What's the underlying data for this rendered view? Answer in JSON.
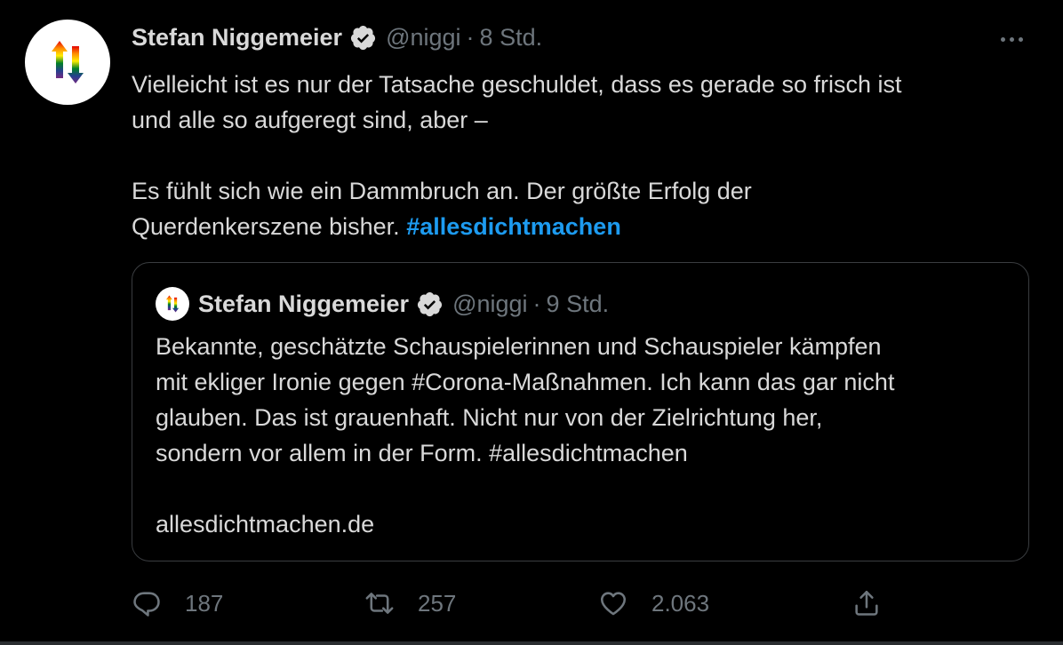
{
  "colors": {
    "background": "#000000",
    "text": "#d9d9d9",
    "secondary": "#6e767d",
    "link": "#1d9bf0",
    "border": "#3a3d40"
  },
  "tweet": {
    "author_name": "Stefan Niggemeier",
    "handle": "@niggi",
    "separator": "·",
    "time": "8 Std.",
    "text_line_1": "Vielleicht ist es nur der Tatsache geschuldet, dass es gerade so frisch ist",
    "text_line_2": "und alle so aufgeregt sind, aber –",
    "text_line_3": "Es fühlt sich wie ein Dammbruch an. Der größte Erfolg der",
    "text_line_4": "Querdenkerszene bisher.",
    "hashtag": "#allesdichtmachen"
  },
  "quoted_tweet": {
    "author_name": "Stefan Niggemeier",
    "handle": "@niggi",
    "separator": "·",
    "time": "9 Std.",
    "line_1": "Bekannte, geschätzte Schauspielerinnen und Schauspieler kämpfen",
    "line_2": "mit ekliger Ironie gegen #Corona-Maßnahmen. Ich kann das gar nicht",
    "line_3": "glauben. Das ist grauenhaft. Nicht nur von der Zielrichtung her,",
    "line_4": "sondern vor allem in der Form. #allesdichtmachen",
    "link": "allesdichtmachen.de"
  },
  "actions": {
    "reply": {
      "icon": "reply-icon",
      "count": "187"
    },
    "retweet": {
      "icon": "retweet-icon",
      "count": "257"
    },
    "like": {
      "icon": "heart-icon",
      "count": "2.063"
    },
    "share": {
      "icon": "share-icon"
    }
  },
  "icons": {
    "more": "more-options-icon",
    "verified": "verified-badge-icon"
  }
}
